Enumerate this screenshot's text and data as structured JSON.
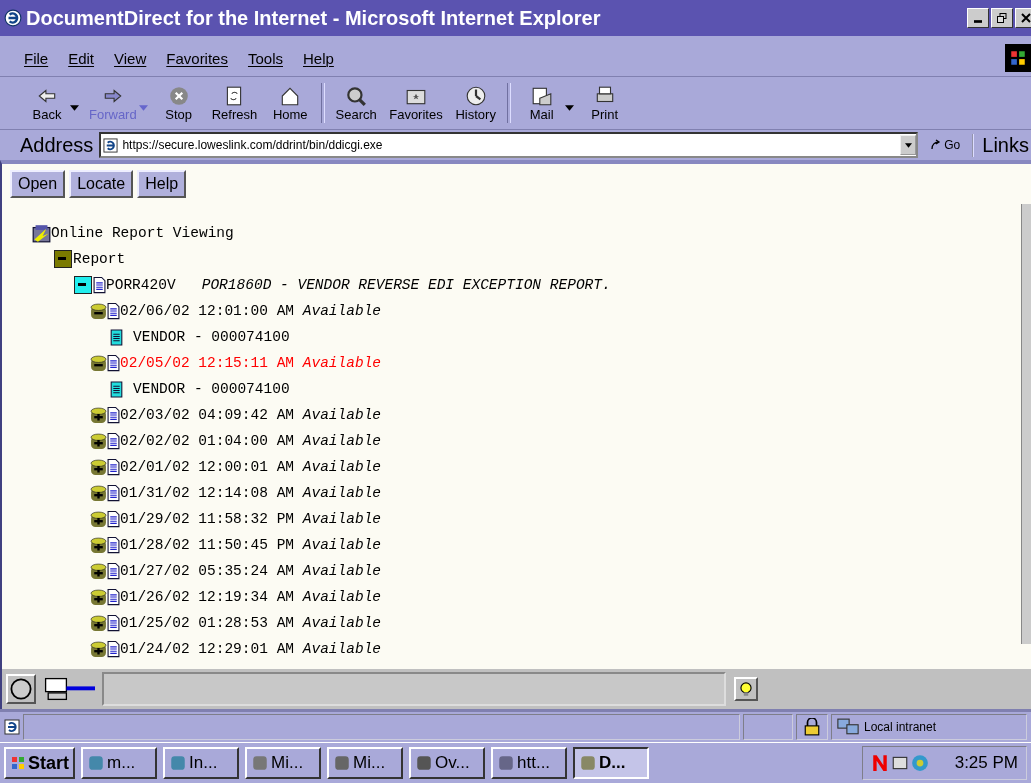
{
  "window": {
    "title": "DocumentDirect for the Internet - Microsoft Internet Explorer"
  },
  "menu": [
    "File",
    "Edit",
    "View",
    "Favorites",
    "Tools",
    "Help"
  ],
  "toolbar": [
    {
      "label": "Back",
      "disabled": false,
      "dropdown": true
    },
    {
      "label": "Forward",
      "disabled": true,
      "dropdown": true
    },
    {
      "label": "Stop",
      "disabled": false,
      "dropdown": false
    },
    {
      "label": "Refresh",
      "disabled": false,
      "dropdown": false
    },
    {
      "label": "Home",
      "disabled": false,
      "dropdown": false
    },
    {
      "label": "Search",
      "disabled": false,
      "dropdown": false
    },
    {
      "label": "Favorites",
      "disabled": false,
      "dropdown": false
    },
    {
      "label": "History",
      "disabled": false,
      "dropdown": false
    },
    {
      "label": "Mail",
      "disabled": false,
      "dropdown": true
    },
    {
      "label": "Print",
      "disabled": false,
      "dropdown": false
    }
  ],
  "address": {
    "label": "Address",
    "url": "https://secure.loweslink.com/ddrint/bin/ddicgi.exe",
    "go": "Go",
    "links": "Links"
  },
  "page_buttons": [
    "Open",
    "Locate",
    "Help"
  ],
  "tree": {
    "label": "Online Report Viewing",
    "children": [
      {
        "label": "Report",
        "expanded": true,
        "children": [
          {
            "label": "PORR420V",
            "description": "POR1860D - VENDOR REVERSE EDI EXCEPTION REPORT.",
            "expanded": true,
            "children": [
              {
                "date": "02/06/02 12:01:00 AM",
                "status": "Available",
                "expanded": true,
                "selected": false,
                "children": [
                  {
                    "label": "VENDOR - 000074100"
                  }
                ]
              },
              {
                "date": "02/05/02 12:15:11 AM",
                "status": "Available",
                "expanded": true,
                "selected": true,
                "children": [
                  {
                    "label": "VENDOR - 000074100"
                  }
                ]
              },
              {
                "date": "02/03/02 04:09:42 AM",
                "status": "Available",
                "expanded": false,
                "selected": false
              },
              {
                "date": "02/02/02 01:04:00 AM",
                "status": "Available",
                "expanded": false,
                "selected": false
              },
              {
                "date": "02/01/02 12:00:01 AM",
                "status": "Available",
                "expanded": false,
                "selected": false
              },
              {
                "date": "01/31/02 12:14:08 AM",
                "status": "Available",
                "expanded": false,
                "selected": false
              },
              {
                "date": "01/29/02 11:58:32 PM",
                "status": "Available",
                "expanded": false,
                "selected": false
              },
              {
                "date": "01/28/02 11:50:45 PM",
                "status": "Available",
                "expanded": false,
                "selected": false
              },
              {
                "date": "01/27/02 05:35:24 AM",
                "status": "Available",
                "expanded": false,
                "selected": false
              },
              {
                "date": "01/26/02 12:19:34 AM",
                "status": "Available",
                "expanded": false,
                "selected": false
              },
              {
                "date": "01/25/02 01:28:53 AM",
                "status": "Available",
                "expanded": false,
                "selected": false
              },
              {
                "date": "01/24/02 12:29:01 AM",
                "status": "Available",
                "expanded": false,
                "selected": false
              }
            ]
          }
        ]
      }
    ]
  },
  "status_bar": {
    "zone": "Local intranet"
  },
  "taskbar": {
    "start": "Start",
    "items": [
      {
        "label": "m...",
        "selected": false
      },
      {
        "label": "In...",
        "selected": false
      },
      {
        "label": "Mi...",
        "selected": false
      },
      {
        "label": "Mi...",
        "selected": false
      },
      {
        "label": "Ov...",
        "selected": false
      },
      {
        "label": "htt...",
        "selected": false
      },
      {
        "label": "D...",
        "selected": true
      }
    ],
    "clock": "3:25 PM"
  }
}
